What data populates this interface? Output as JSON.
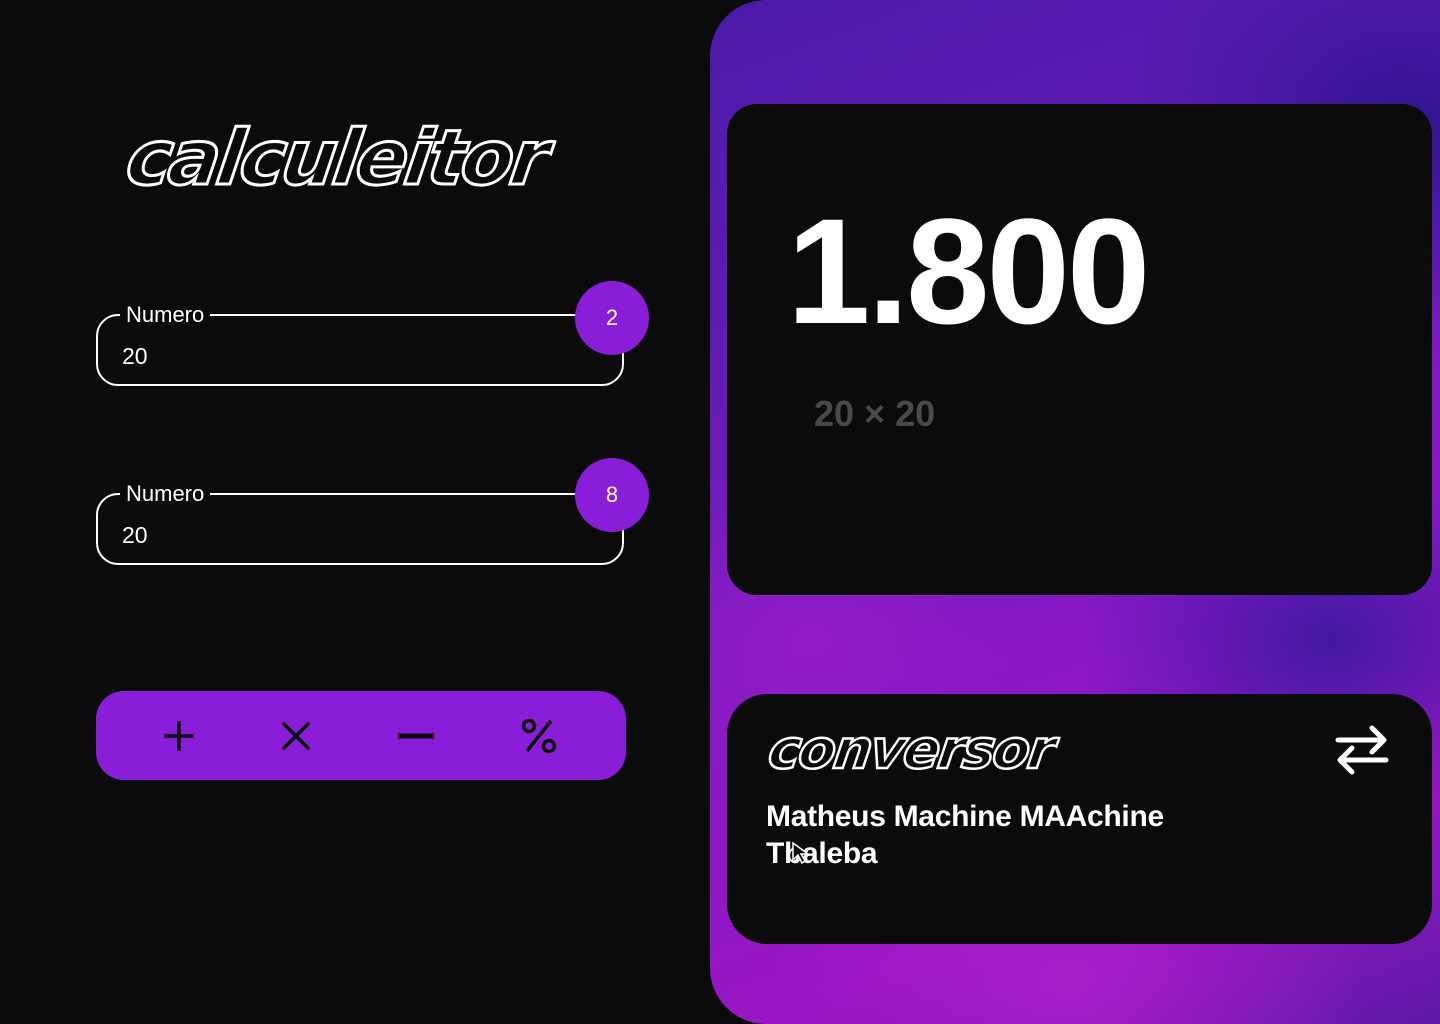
{
  "calculator": {
    "logo_text": "calculeitor",
    "fields": [
      {
        "label": "Numero",
        "value": "20",
        "badge": "2"
      },
      {
        "label": "Numero",
        "value": "20",
        "badge": "8"
      }
    ],
    "operations": [
      {
        "name": "add",
        "icon": "plus-icon"
      },
      {
        "name": "multiply",
        "icon": "times-icon"
      },
      {
        "name": "subtract",
        "icon": "minus-icon"
      },
      {
        "name": "percent",
        "icon": "percent-icon"
      }
    ],
    "accent_color": "#8a1ed8"
  },
  "result": {
    "value": "1.800",
    "expression": "20 × 20"
  },
  "converter": {
    "logo_text": "conversor",
    "swap_icon": "swap-arrows-icon",
    "text": "Matheus Machine MAAchine Tbaleba"
  }
}
